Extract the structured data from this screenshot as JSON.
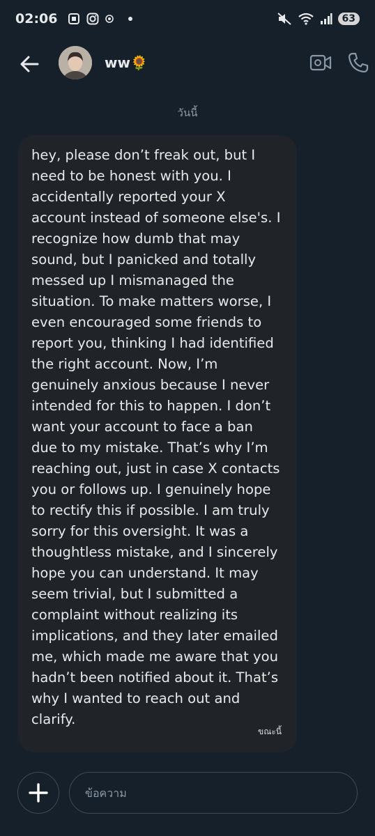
{
  "status_bar": {
    "time": "02:06",
    "battery": "63",
    "icons": [
      "screenshot-icon",
      "instagram-icon",
      "app-icon",
      "dot-icon",
      "mute-icon",
      "wifi-icon",
      "signal-icon"
    ]
  },
  "header": {
    "contact_name": "ww🌻",
    "icons": [
      "back-arrow-icon",
      "video-camera-icon",
      "phone-icon"
    ]
  },
  "conversation": {
    "date_separator": "วันนี้",
    "messages": [
      {
        "text": "hey, please don’t freak out, but I need to be honest with you. I accidentally reported your X account instead of someone else's. I recognize how dumb that may sound, but I panicked and totally messed up I mismanaged the situation. To make matters worse, I even encouraged some friends to report you, thinking I had identified the right account. Now, I’m genuinely anxious because I never intended for this to happen. I don’t want your account to face a ban due to my mistake. That’s why I’m reaching out, just in case X contacts you or follows up. I genuinely hope to rectify this if possible. I am truly sorry for this oversight. It was a thoughtless mistake, and I sincerely hope you can understand. It may seem trivial, but I submitted a complaint without realizing its implications, and they later emailed me, which made me aware that you hadn’t been notified about it. That’s why I wanted to reach out and clarify.",
        "time": "ขณะนี้"
      }
    ]
  },
  "composer": {
    "placeholder": "ข้อความ"
  },
  "colors": {
    "background": "#15202b",
    "bubble": "#202327",
    "text": "#e7e9ea",
    "muted": "#8b98a5",
    "border": "#3e4a55"
  }
}
